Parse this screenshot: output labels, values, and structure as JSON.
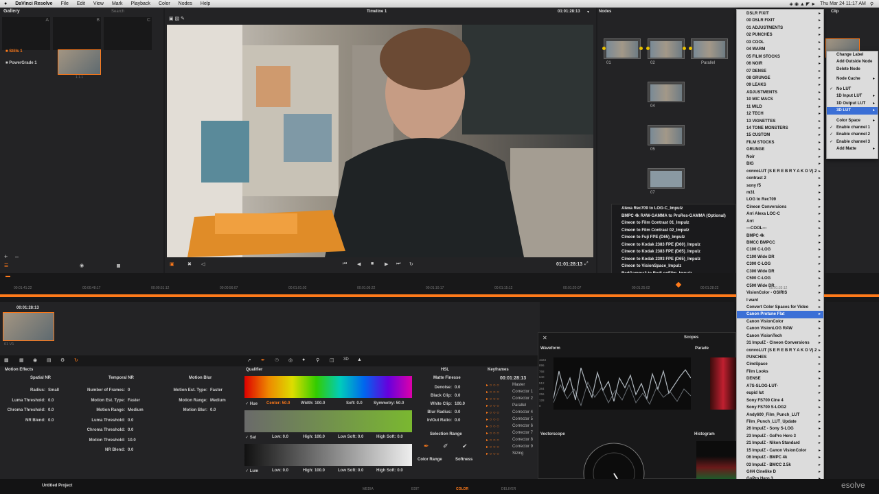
{
  "menubar": {
    "apple": "",
    "app": "DaVinci Resolve",
    "items": [
      "File",
      "Edit",
      "View",
      "Mark",
      "Playback",
      "Color",
      "Nodes",
      "Help"
    ],
    "clock": "Thu Mar 24  11:17 AM"
  },
  "gallery": {
    "title": "Gallery",
    "search_placeholder": "Search",
    "slots": [
      "A",
      "B",
      "C"
    ],
    "albums": [
      "Stills 1",
      "PowerGrade 1"
    ],
    "still_label": "1.1.1"
  },
  "viewer": {
    "timeline_name": "Timeline 1",
    "timecode_top": "01:01:28:13",
    "timecode_bottom": "01:01:28:13"
  },
  "nodes": {
    "title": "Nodes",
    "labels": [
      "01",
      "02",
      "Parallel",
      "04",
      "05",
      "07"
    ]
  },
  "clip": {
    "title": "Clip"
  },
  "ruler": [
    "00:01:41:22",
    "00:00:48:17",
    "00:00:51:12",
    "00:00:56:07",
    "00:01:01:02",
    "00:01:05:22",
    "00:01:10:17",
    "00:01:15:12",
    "00:01:20:07",
    "00:01:25:02",
    "00:01:28:22",
    "00:01:33:12"
  ],
  "thumbnail": {
    "timecode": "00:01:28:13",
    "label": "01  V1"
  },
  "motion": {
    "title": "Motion Effects",
    "spatial_title": "Spatial NR",
    "temporal_title": "Temporal NR",
    "blur_title": "Motion Blur",
    "spatial": [
      [
        "Radius:",
        "Small"
      ],
      [
        "Luma Threshold:",
        "0.0"
      ],
      [
        "Chroma Threshold:",
        "0.0"
      ],
      [
        "NR Blend:",
        "0.0"
      ]
    ],
    "temporal": [
      [
        "Number of Frames:",
        "0"
      ],
      [
        "Motion Est. Type:",
        "Faster"
      ],
      [
        "Motion Range:",
        "Medium"
      ],
      [
        "Luma Threshold:",
        "0.0"
      ],
      [
        "Chroma Threshold:",
        "0.0"
      ],
      [
        "Motion Threshold:",
        "10.0"
      ],
      [
        "NR Blend:",
        "0.0"
      ]
    ],
    "blur": [
      [
        "Motion Est. Type:",
        "Faster"
      ],
      [
        "Motion Range:",
        "Medium"
      ],
      [
        "Motion Blur:",
        "0.0"
      ]
    ]
  },
  "qualifier": {
    "title": "Qualifier",
    "hue": "Hue",
    "hue_center": "Center: 50.0",
    "hue_width": "Width: 100.0",
    "hue_soft": "Soft: 0.0",
    "hue_sym": "Symmetry: 50.0",
    "sat": "Sat",
    "sat_low": "Low: 0.0",
    "sat_high": "High: 100.0",
    "sat_lsoft": "Low Soft: 0.0",
    "sat_hsoft": "High Soft: 0.0",
    "lum": "Lum",
    "lum_low": "Low: 0.0",
    "lum_high": "High: 100.0",
    "lum_lsoft": "Low Soft: 0.0",
    "lum_hsoft": "High Soft: 0.0"
  },
  "hsl": {
    "title": "HSL",
    "matte": "Matte Finesse",
    "rows": [
      [
        "Denoise:",
        "0.0"
      ],
      [
        "Black Clip:",
        "0.0"
      ],
      [
        "White Clip:",
        "100.0"
      ],
      [
        "Blur Radius:",
        "0.0"
      ],
      [
        "In/Out Ratio:",
        "0.0"
      ]
    ],
    "sel_range": "Selection Range",
    "color_range": "Color Range",
    "softness": "Softness"
  },
  "keyframes": {
    "title": "Keyframes",
    "timecode": "00:01:28:13",
    "rows": [
      "Master",
      "Corrector 1",
      "Corrector 2",
      "Parallel",
      "Corrector 4",
      "Corrector 5",
      "Corrector 6",
      "Corrector 7",
      "Corrector 8",
      "Corrector 9",
      "Sizing"
    ]
  },
  "scopes": {
    "title": "Scopes",
    "waveform": "Waveform",
    "parade": "Parade",
    "vectorscope": "Vectorscope",
    "histogram": "Histogram",
    "scale": [
      "1023",
      "896",
      "768",
      "640",
      "512",
      "384",
      "256",
      "128",
      "0"
    ]
  },
  "nav": {
    "project": "Untitled Project",
    "pages": [
      "MEDIA",
      "EDIT",
      "COLOR",
      "DELIVER"
    ],
    "brand": "esolve"
  },
  "lut_list": [
    "Alexa Rec709 to LOG-C_Impulz",
    "BMPC 4k RAW-GAMMA to ProRes-GAMMA (Optional)",
    "Cineon to Film Contrast 01_Impulz",
    "Cineon to Film Contrast 02_Impulz",
    "Cineon to Fuji FPE (D65)_Impulz",
    "Cineon to Kodak 2383 FPE (D60)_Impulz",
    "Cineon to Kodak 2383 FPE (D65)_Impulz",
    "Cineon to Kodak 2393 FPE (D65)_Impulz",
    "Cineon to VisionSpace_Impulz",
    "RedGamma3 to RedLogFilm_Impulz"
  ],
  "lut_folders": [
    "DSLR FIXIT",
    "00 DSLR FIXIT",
    "01 ADJUSTMENTS",
    "02 PUNCHES",
    "03 COOL",
    "04 WARM",
    "05 FILM STOCKS",
    "06 NOIR",
    "07 DENSE",
    "08 GRUNGE",
    "09 LEAKS",
    "ADJUSTMENTS",
    "10 MIC MACS",
    "11 MILD",
    "12 TECH",
    "13 VIGNETTES",
    "14 TONE MONSTERS",
    "15 CUSTOM",
    "FILM STOCKS",
    "GRUNGE",
    "Noir",
    "BIG",
    "convoLUT (S E R E B R Y A K O V) 2",
    "contrast 2",
    "sony f5",
    "m31",
    "LOG to Rec709",
    "Cineon Conversions",
    "Arri Alexa LOC-C",
    "Arri",
    "---COOL---",
    "BMPC 4k",
    "BMCC  BMPCC",
    "C100 C-LOG",
    "C100 Wide DR",
    "C300 C-LOG",
    "C300 Wide DR",
    "C500 C-LOG",
    "C500 Wide DR",
    "VisionColor - OSIRIS",
    "I want",
    "Convert Color Spaces for Video",
    "Canon Protune Flat",
    "Canon VisionColor",
    "Canon VisionLOG RAW",
    "Canon VisionTech",
    "31 ImpulZ - Cineon Conversions",
    "convoLUT (S E R E B R Y A K O V) 2",
    "PUNCHES",
    "CineSpace",
    "Film Looks",
    "DENSE",
    "A7S-SLOG-LUT-",
    "eupid lut",
    "Sony FS700 Cine 4",
    "Sony FS700 S-LOG2",
    "Andy600_Film_Punch_LUT",
    "Film_Punch_LUT_Update",
    "26 ImpulZ - Sony S-LOG",
    "23 ImpulZ - GoPro Hero 3",
    "21 ImpulZ - Nikon Standard",
    "15 ImpulZ - Canon VisionColor",
    "06 ImpulZ - BMPC 4k",
    "03 ImpulZ - BMCC 2.5k",
    "GH4 Cinelike D",
    "GoPro Hero 3"
  ],
  "lut_selected_index": 42,
  "context_menu": [
    "Change Label",
    "Add Outside Node",
    "Delete Node",
    "",
    "Node Cache",
    "",
    "No LUT",
    "1D Input LUT",
    "1D Output LUT",
    "3D LUT",
    "",
    "Color Space",
    "Enable channel 1",
    "Enable channel 2",
    "Enable channel 3",
    "Add Matte"
  ],
  "context_checks": [
    false,
    false,
    false,
    false,
    false,
    false,
    true,
    false,
    false,
    false,
    false,
    false,
    true,
    true,
    true,
    false
  ],
  "context_arrows": [
    false,
    false,
    false,
    false,
    true,
    false,
    false,
    true,
    true,
    true,
    false,
    true,
    false,
    false,
    false,
    true
  ],
  "context_selected_index": 9,
  "colors": {
    "accent": "#ff7a1a",
    "menu_select": "#3b6fd6",
    "node_link": "#e8c000"
  }
}
